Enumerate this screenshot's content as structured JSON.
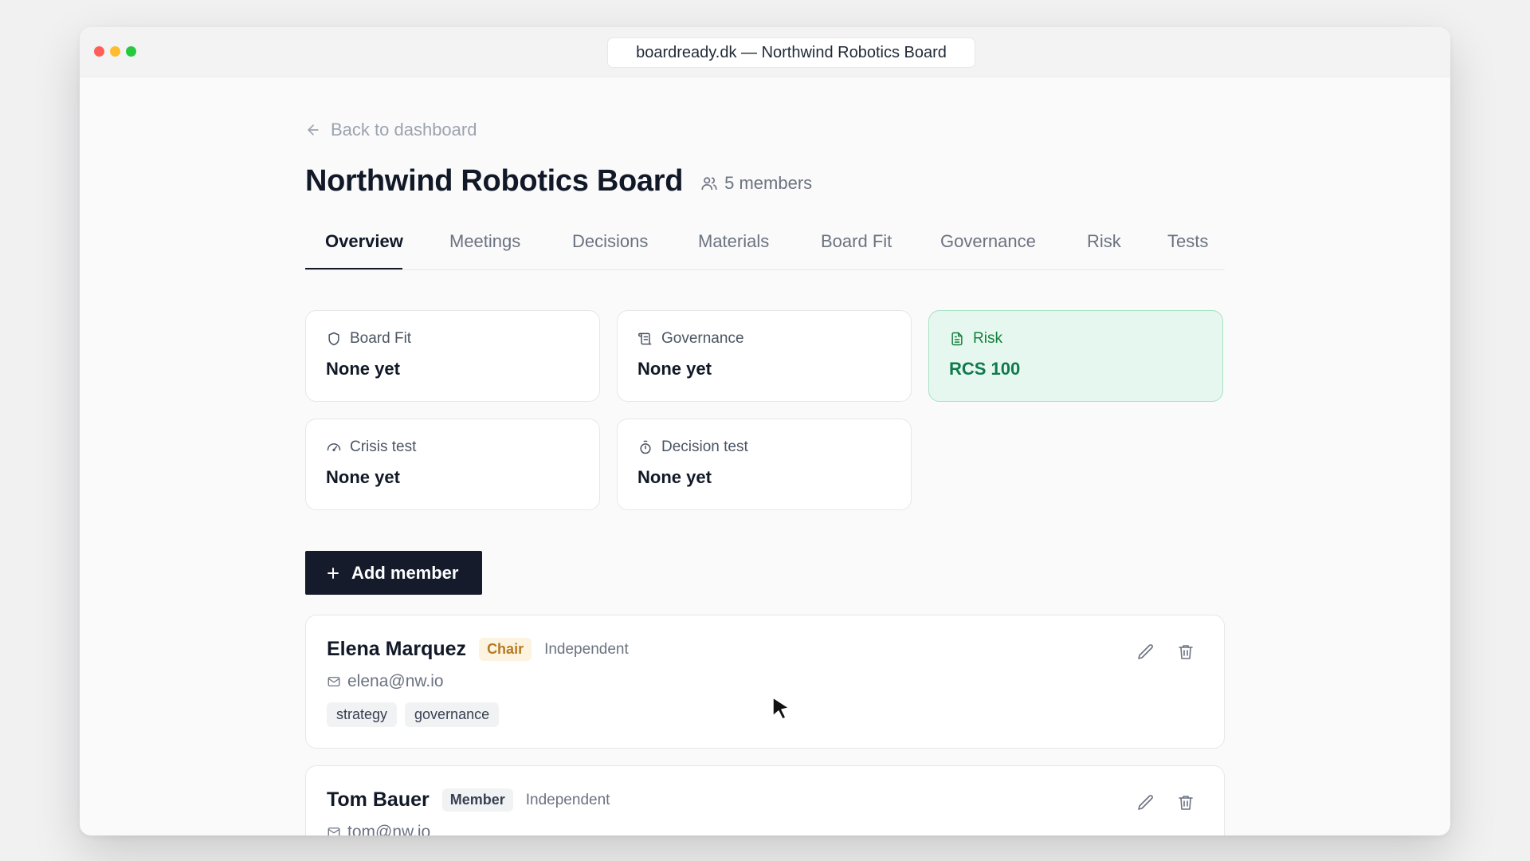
{
  "browser": {
    "url": "boardready.dk — Northwind Robotics Board"
  },
  "page": {
    "back_label": "Back to dashboard",
    "title": "Northwind Robotics Board",
    "members_count": "5 members"
  },
  "tabs": [
    {
      "label": "Overview",
      "active": true
    },
    {
      "label": "Meetings"
    },
    {
      "label": "Decisions"
    },
    {
      "label": "Materials"
    },
    {
      "label": "Board Fit"
    },
    {
      "label": "Governance"
    },
    {
      "label": "Risk"
    },
    {
      "label": "Tests"
    }
  ],
  "cards": [
    {
      "label": "Board Fit",
      "value": "None yet",
      "icon": "shield-icon"
    },
    {
      "label": "Governance",
      "value": "None yet",
      "icon": "scroll-icon"
    },
    {
      "label": "Risk",
      "value": "RCS 100",
      "icon": "document-icon",
      "highlight": true
    },
    {
      "label": "Crisis test",
      "value": "None yet",
      "icon": "gauge-icon"
    },
    {
      "label": "Decision test",
      "value": "None yet",
      "icon": "timer-icon"
    }
  ],
  "add_member_label": "Add member",
  "members": [
    {
      "name": "Elena Marquez",
      "role": "Chair",
      "type": "Independent",
      "email": "elena@nw.io",
      "tags": [
        "strategy",
        "governance"
      ]
    },
    {
      "name": "Tom Bauer",
      "role": "Member",
      "type": "Independent",
      "email": "tom@nw.io",
      "tags": []
    }
  ],
  "colors": {
    "accent_dark": "#151b2b",
    "risk_green": "#0f7a4d",
    "risk_bg": "#e6f7ef",
    "chair_badge": "#b7791f"
  }
}
